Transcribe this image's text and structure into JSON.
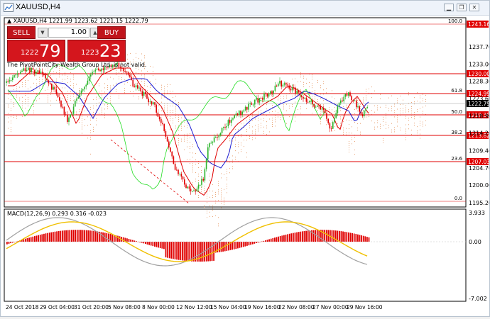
{
  "window": {
    "title": "XAUUSD,H4",
    "minimize_label": "▁",
    "restore_label": "❐",
    "close_label": "✕"
  },
  "chart_header": {
    "symbol_line": "▲ XAUUSD,H4  1221.99 1223.62 1221.15 1222.79",
    "notice": "The PivotPointCity Wealth Group Ltd. is not valid."
  },
  "trade_panel": {
    "sell_label": "SELL",
    "buy_label": "BUY",
    "volume": "1.00",
    "bid_prefix": "1222",
    "bid_big": "79",
    "ask_prefix": "1223",
    "ask_big": "23",
    "down_icon": "▼",
    "up_icon": "▲"
  },
  "price_axis": [
    "1237.70",
    "1233.00",
    "1228.30",
    "1223.60",
    "1218.90",
    "1214.20",
    "1209.40",
    "1204.70",
    "1200.00",
    "1195.20"
  ],
  "fib_levels": [
    {
      "label": "100.0",
      "price": "1243.16"
    },
    {
      "label": "61.8",
      "price": "1224.99"
    },
    {
      "label": "50.0",
      "price": "1219.30"
    },
    {
      "label": "38.2",
      "price": "1213.82"
    },
    {
      "label": "23.6",
      "price": "1207.03"
    },
    {
      "label": "0.0",
      "price": ""
    }
  ],
  "extra_price_tags": [
    "1230.00"
  ],
  "current_price": "1222.79",
  "macd": {
    "label": "MACD(12,26,9) 0.293 0.316 -0.023",
    "axis_top": "3.933",
    "axis_mid": "0.00",
    "axis_bottom": "-7.002"
  },
  "time_axis": [
    "24 Oct 2018",
    "29 Oct 04:00",
    "31 Oct 20:00",
    "5 Nov 08:00",
    "8 Nov 00:00",
    "12 Nov 12:00",
    "15 Nov 04:00",
    "19 Nov 16:00",
    "22 Nov 08:00",
    "27 Nov 00:00",
    "29 Nov 16:00"
  ],
  "colors": {
    "bull": "#2bb52b",
    "bear": "#e00000",
    "fib": "#e00000",
    "ma_red": "#e00000",
    "ma_blue": "#1a1ad0",
    "ma_green": "#22dd22",
    "macd_signal": "#f0c000",
    "macd_line": "#a0a0a0"
  }
}
